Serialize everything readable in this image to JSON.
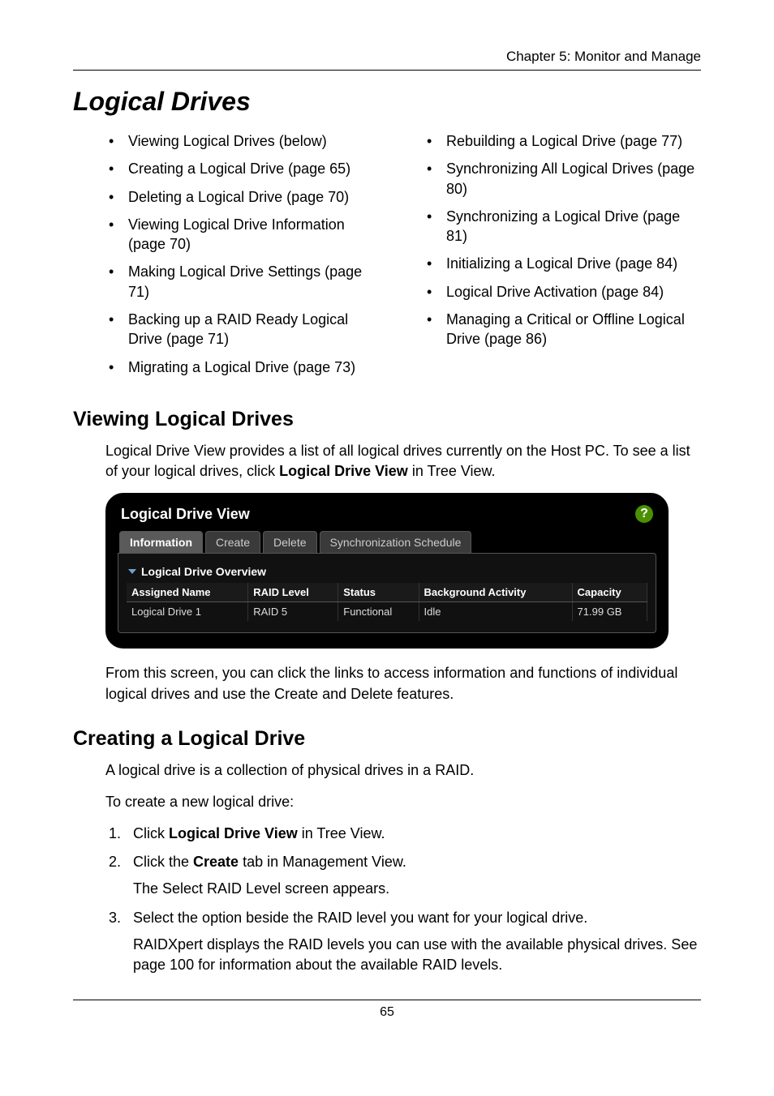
{
  "header": "Chapter 5: Monitor and Manage",
  "title": "Logical Drives",
  "bullets_left": [
    "Viewing Logical Drives (below)",
    "Creating a Logical Drive (page 65)",
    "Deleting a Logical Drive (page 70)",
    "Viewing Logical Drive Information (page 70)",
    "Making Logical Drive Settings (page 71)",
    "Backing up a RAID Ready Logical Drive (page 71)",
    "Migrating a Logical Drive (page 73)"
  ],
  "bullets_right": [
    "Rebuilding a Logical Drive (page 77)",
    "Synchronizing All Logical Drives (page 80)",
    "Synchronizing a Logical Drive (page 81)",
    "Initializing a Logical Drive (page 84)",
    "Logical Drive Activation (page 84)",
    "Managing a Critical or Offline Logical Drive (page 86)"
  ],
  "section1": {
    "heading": "Viewing Logical Drives",
    "para_before": "Logical Drive View provides a list of all logical drives currently on the Host PC. To see a list of your logical drives, click ",
    "para_bold": "Logical Drive View",
    "para_after": " in Tree View.",
    "para2": "From this screen, you can click the links to access information and functions of individual logical drives and use the Create and Delete features."
  },
  "panel": {
    "title": "Logical Drive View",
    "help": "?",
    "tabs": [
      "Information",
      "Create",
      "Delete",
      "Synchronization Schedule"
    ],
    "overview_label": "Logical Drive Overview",
    "columns": [
      "Assigned Name",
      "RAID Level",
      "Status",
      "Background Activity",
      "Capacity"
    ],
    "row": [
      "Logical Drive 1",
      "RAID 5",
      "Functional",
      "Idle",
      "71.99 GB"
    ]
  },
  "section2": {
    "heading": "Creating a Logical Drive",
    "p1": "A logical drive is a collection of physical drives in a RAID.",
    "p2": "To create a new logical drive:",
    "step1_a": "Click ",
    "step1_b": "Logical Drive View",
    "step1_c": " in Tree View.",
    "step2_a": "Click the ",
    "step2_b": "Create",
    "step2_c": " tab in Management View.",
    "step2_sub": "The Select RAID Level screen appears.",
    "step3_a": "Select the option beside the RAID level you want for your logical drive.",
    "step3_sub": "RAIDXpert displays the RAID levels you can use with the available physical drives. See page 100 for information about the available RAID levels."
  },
  "footer": "65"
}
